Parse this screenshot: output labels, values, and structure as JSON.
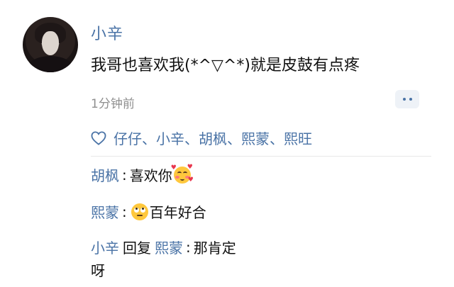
{
  "post": {
    "username": "小辛",
    "text": "我哥也喜欢我(*^▽^*)就是皮鼓有点疼",
    "time": "1分钟前",
    "likes_names": "仔仔、小辛、胡枫、熙蒙、熙旺"
  },
  "comments": [
    {
      "author": "胡枫",
      "colon": ":",
      "text": "喜欢你",
      "emoji": "smiling-face-with-hearts"
    },
    {
      "author": "熙蒙",
      "colon": ":",
      "text": "百年好合",
      "emoji": "face-with-rolling-eyes"
    },
    {
      "author": "小辛",
      "reply_word": "回复",
      "reply_to": "熙蒙",
      "colon": ":",
      "text_line1": "那肯定",
      "text_line2": "呀"
    }
  ],
  "colors": {
    "link": "#4a73a6",
    "text": "#111111",
    "meta": "#8f8f8f"
  },
  "icons": {
    "like": "heart-outline-icon",
    "more": "more-dots-icon"
  }
}
